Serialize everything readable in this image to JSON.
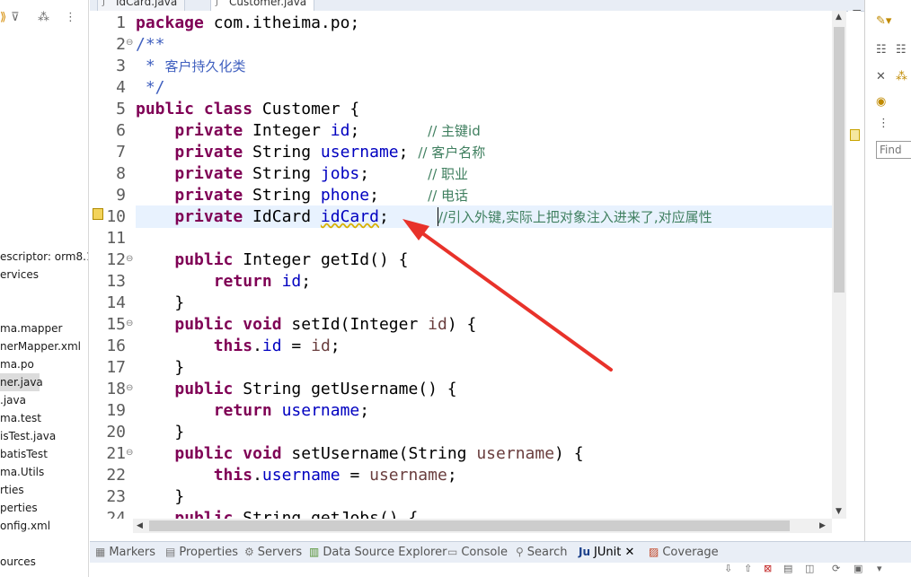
{
  "explorer": {
    "items": [
      {
        "label": "escriptor: orm8.1",
        "selected": false
      },
      {
        "label": "ervices",
        "selected": false
      },
      {
        "label": "",
        "selected": false
      },
      {
        "label": "ma.mapper",
        "selected": false
      },
      {
        "label": "nerMapper.xml",
        "selected": false
      },
      {
        "label": "ma.po",
        "selected": false
      },
      {
        "label": "ner.java",
        "selected": true
      },
      {
        "label": ".java",
        "selected": false
      },
      {
        "label": "ma.test",
        "selected": false
      },
      {
        "label": "isTest.java",
        "selected": false
      },
      {
        "label": "batisTest",
        "selected": false
      },
      {
        "label": "ma.Utils",
        "selected": false
      },
      {
        "label": "rties",
        "selected": false
      },
      {
        "label": "perties",
        "selected": false
      },
      {
        "label": "onfig.xml",
        "selected": false
      },
      {
        "label": "",
        "selected": false
      },
      {
        "label": "ources",
        "selected": false
      }
    ]
  },
  "editor": {
    "tabs": [
      {
        "label": "IdCard.java",
        "active": false
      },
      {
        "label": "Customer.java",
        "active": true
      }
    ],
    "tab_close": "✕",
    "line_numbers": [
      "1",
      "2",
      "3",
      "4",
      "5",
      "6",
      "7",
      "8",
      "9",
      "10",
      "11",
      "12",
      "13",
      "14",
      "15",
      "16",
      "17",
      "18",
      "19",
      "20",
      "21",
      "22",
      "23",
      "24"
    ],
    "lines": {
      "l1": {
        "kw": "package",
        "rest": " com.itheima.po;"
      },
      "l2": {
        "jd": "/**"
      },
      "l3": {
        "jd": " * ",
        "jdt": "客户持久化类"
      },
      "l4": {
        "jd": " */"
      },
      "l5": {
        "kw1": "public",
        "kw2": "class",
        "rest": " Customer {"
      },
      "l6": {
        "kw": "private",
        "type": " Integer ",
        "field": "id",
        "punct": ";",
        "pad": "       ",
        "cm": "// 主键id"
      },
      "l7": {
        "kw": "private",
        "type": " String ",
        "field": "username",
        "punct": ";",
        "pad": " ",
        "cm": "// 客户名称"
      },
      "l8": {
        "kw": "private",
        "type": " String ",
        "field": "jobs",
        "punct": ";",
        "pad": "      ",
        "cm": "// 职业"
      },
      "l9": {
        "kw": "private",
        "type": " String ",
        "field": "phone",
        "punct": ";",
        "pad": "     ",
        "cm": "// 电话"
      },
      "l10": {
        "kw": "private",
        "type": " IdCard ",
        "field": "idCard",
        "punct": ";",
        "pad": "     ",
        "cm": "//引入外键,实际上把对象注入进来了,对应属性"
      },
      "l12": {
        "kw": "public",
        "type": " Integer ",
        "rest": "getId() {"
      },
      "l13": {
        "kw": "return",
        "field": "id",
        "punct": ";"
      },
      "l14": {
        "rest": "}"
      },
      "l15": {
        "kw1": "public",
        "kw2": "void",
        "rest1": " setId(Integer ",
        "param": "id",
        "rest2": ") {"
      },
      "l16": {
        "kw": "this",
        "dot": ".",
        "field": "id",
        "rest1": " = ",
        "param": "id",
        "punct": ";"
      },
      "l17": {
        "rest": "}"
      },
      "l18": {
        "kw": "public",
        "type": " String ",
        "rest": "getUsername() {"
      },
      "l19": {
        "kw": "return",
        "field": "username",
        "punct": ";"
      },
      "l20": {
        "rest": "}"
      },
      "l21": {
        "kw1": "public",
        "kw2": "void",
        "rest1": " setUsername(String ",
        "param": "username",
        "rest2": ") {"
      },
      "l22": {
        "kw": "this",
        "dot": ".",
        "field": "username",
        "rest1": " = ",
        "param": "username",
        "punct": ";"
      },
      "l23": {
        "rest": "}"
      },
      "l24": {
        "kw": "public",
        "type": " String ",
        "rest": "getJobs() {"
      }
    }
  },
  "outline": {
    "find_placeholder": "Find"
  },
  "bottom_tabs": [
    {
      "label": "Markers",
      "icon": "markers-icon",
      "active": false
    },
    {
      "label": "Properties",
      "icon": "properties-icon",
      "active": false
    },
    {
      "label": "Servers",
      "icon": "servers-icon",
      "active": false
    },
    {
      "label": "Data Source Explorer",
      "icon": "data-source-icon",
      "active": false
    },
    {
      "label": "Console",
      "icon": "console-icon",
      "active": false
    },
    {
      "label": "Search",
      "icon": "search-icon",
      "active": false
    },
    {
      "label": "JUnit",
      "icon": "junit-icon",
      "active": true
    },
    {
      "label": "Coverage",
      "icon": "coverage-icon",
      "active": false
    }
  ],
  "junit_close": "✕",
  "colors": {
    "keyword": "#7f0055",
    "field": "#0000c0",
    "comment": "#3f7f5f",
    "javadoc": "#3f5fbf",
    "annotation_arrow": "#e8322a"
  }
}
